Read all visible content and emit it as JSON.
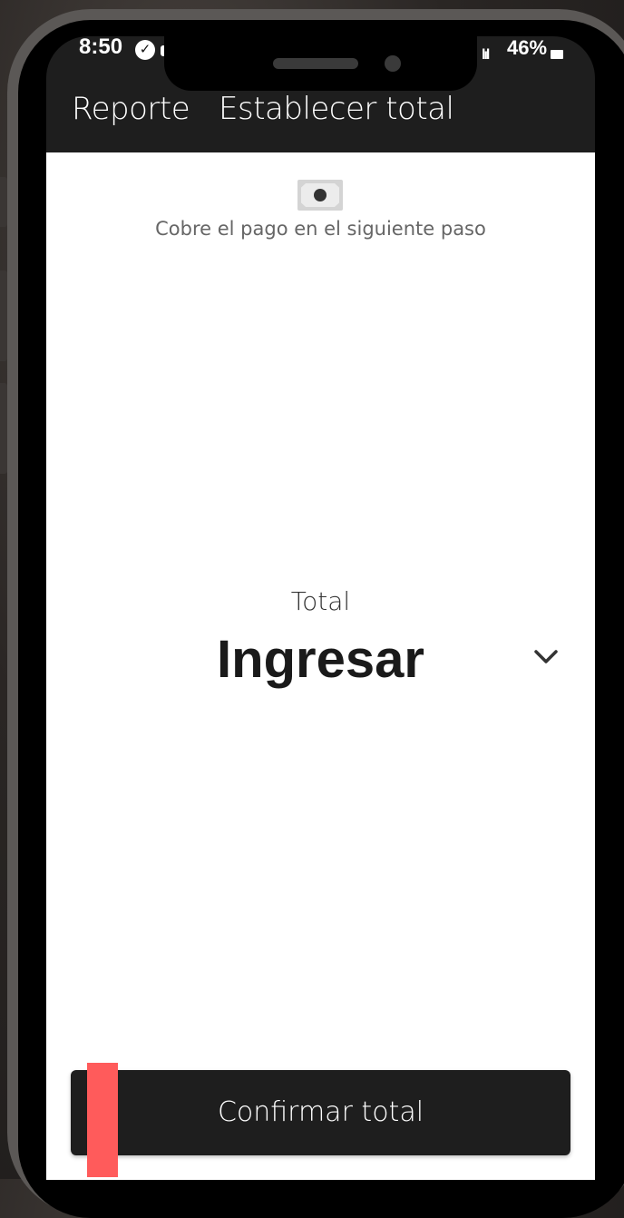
{
  "status_bar": {
    "time": "8:50",
    "battery": "46%"
  },
  "header": {
    "tabs": [
      {
        "label": "Reporte"
      },
      {
        "label": "Establecer total"
      }
    ]
  },
  "main": {
    "hint": "Cobre el pago en el siguiente paso",
    "total_label": "Total",
    "total_value": "Ingresar",
    "icons": {
      "cash": "cash-icon",
      "dropdown": "chevron-down-icon"
    }
  },
  "footer": {
    "confirm_label": "Confirmar total"
  },
  "colors": {
    "header_bg": "#1e1e1e",
    "content_bg": "#ffffff",
    "button_bg": "#1e1e1e",
    "marker": "#ff5b5b"
  }
}
